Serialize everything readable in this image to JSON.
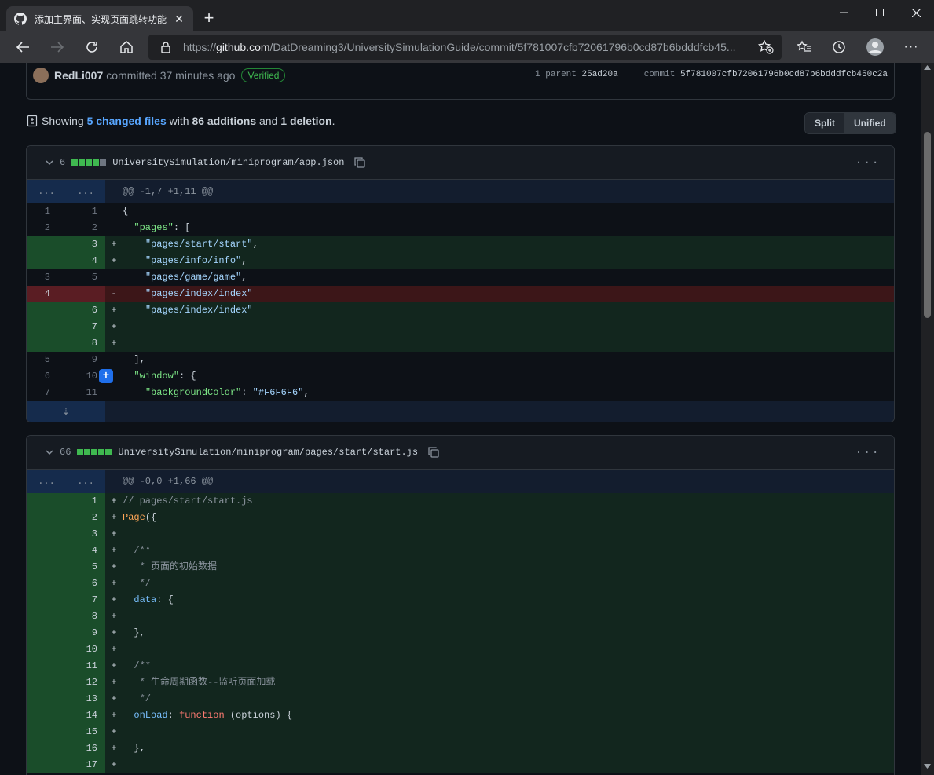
{
  "browser": {
    "tab_title": "添加主界面、实现页面跳转功能",
    "url_host": "github.com",
    "url_prefix": "https://",
    "url_path": "/DatDreaming3/UniversitySimulationGuide/commit/5f781007cfb72061796b0cd87b6bdddfcb45..."
  },
  "commit": {
    "author": "RedLi007",
    "committed_text": "committed 37 minutes ago",
    "verified": "Verified",
    "parent_label": "1 parent",
    "parent_sha": "25ad20a",
    "commit_label": "commit",
    "commit_sha": "5f781007cfb72061796b0cd87b6bdddfcb450c2a"
  },
  "summary": {
    "showing": "Showing",
    "changed_files": "5 changed files",
    "with": "with",
    "additions": "86 additions",
    "and": "and",
    "deletions": "1 deletion",
    "period": "."
  },
  "view_toggle": {
    "split": "Split",
    "unified": "Unified"
  },
  "files": [
    {
      "count": "6",
      "name": "UniversitySimulation/miniprogram/app.json",
      "hunk": "@@ -1,7 +1,11 @@",
      "hunk_ln": "...",
      "lines": [
        {
          "type": "ctx",
          "old": "1",
          "new": "1",
          "sign": "",
          "code": "{"
        },
        {
          "type": "ctx",
          "old": "2",
          "new": "2",
          "sign": "",
          "code": "  \"pages\": ["
        },
        {
          "type": "add",
          "old": "",
          "new": "3",
          "sign": "+",
          "code": "    \"pages/start/start\","
        },
        {
          "type": "add",
          "old": "",
          "new": "4",
          "sign": "+",
          "code": "    \"pages/info/info\","
        },
        {
          "type": "ctx",
          "old": "3",
          "new": "5",
          "sign": "",
          "code": "    \"pages/game/game\","
        },
        {
          "type": "del",
          "old": "4",
          "new": "",
          "sign": "-",
          "code": "    \"pages/index/index\""
        },
        {
          "type": "add",
          "old": "",
          "new": "6",
          "sign": "+",
          "code": "    \"pages/index/index\""
        },
        {
          "type": "add",
          "old": "",
          "new": "7",
          "sign": "+",
          "code": ""
        },
        {
          "type": "add",
          "old": "",
          "new": "8",
          "sign": "+",
          "code": ""
        },
        {
          "type": "ctx",
          "old": "5",
          "new": "9",
          "sign": "",
          "code": "  ],"
        },
        {
          "type": "ctx",
          "old": "6",
          "new": "10",
          "sign": "",
          "code": "  \"window\": {"
        },
        {
          "type": "ctx",
          "old": "7",
          "new": "11",
          "sign": "",
          "code": "    \"backgroundColor\": \"#F6F6F6\","
        }
      ]
    },
    {
      "count": "66",
      "name": "UniversitySimulation/miniprogram/pages/start/start.js",
      "hunk": "@@ -0,0 +1,66 @@",
      "hunk_ln": "...",
      "lines": [
        {
          "type": "add",
          "old": "",
          "new": "1",
          "sign": "+",
          "code": "// pages/start/start.js"
        },
        {
          "type": "add",
          "old": "",
          "new": "2",
          "sign": "+",
          "code": "Page({"
        },
        {
          "type": "add",
          "old": "",
          "new": "3",
          "sign": "+",
          "code": ""
        },
        {
          "type": "add",
          "old": "",
          "new": "4",
          "sign": "+",
          "code": "  /**"
        },
        {
          "type": "add",
          "old": "",
          "new": "5",
          "sign": "+",
          "code": "   * 页面的初始数据"
        },
        {
          "type": "add",
          "old": "",
          "new": "6",
          "sign": "+",
          "code": "   */"
        },
        {
          "type": "add",
          "old": "",
          "new": "7",
          "sign": "+",
          "code": "  data: {"
        },
        {
          "type": "add",
          "old": "",
          "new": "8",
          "sign": "+",
          "code": ""
        },
        {
          "type": "add",
          "old": "",
          "new": "9",
          "sign": "+",
          "code": "  },"
        },
        {
          "type": "add",
          "old": "",
          "new": "10",
          "sign": "+",
          "code": ""
        },
        {
          "type": "add",
          "old": "",
          "new": "11",
          "sign": "+",
          "code": "  /**"
        },
        {
          "type": "add",
          "old": "",
          "new": "12",
          "sign": "+",
          "code": "   * 生命周期函数--监听页面加载"
        },
        {
          "type": "add",
          "old": "",
          "new": "13",
          "sign": "+",
          "code": "   */"
        },
        {
          "type": "add",
          "old": "",
          "new": "14",
          "sign": "+",
          "code": "  onLoad: function (options) {"
        },
        {
          "type": "add",
          "old": "",
          "new": "15",
          "sign": "+",
          "code": ""
        },
        {
          "type": "add",
          "old": "",
          "new": "16",
          "sign": "+",
          "code": "  },"
        },
        {
          "type": "add",
          "old": "",
          "new": "17",
          "sign": "+",
          "code": ""
        }
      ]
    }
  ],
  "colors": {
    "add_block": "#3fb950",
    "neutral_block": "#6e7681",
    "link": "#58a6ff"
  }
}
